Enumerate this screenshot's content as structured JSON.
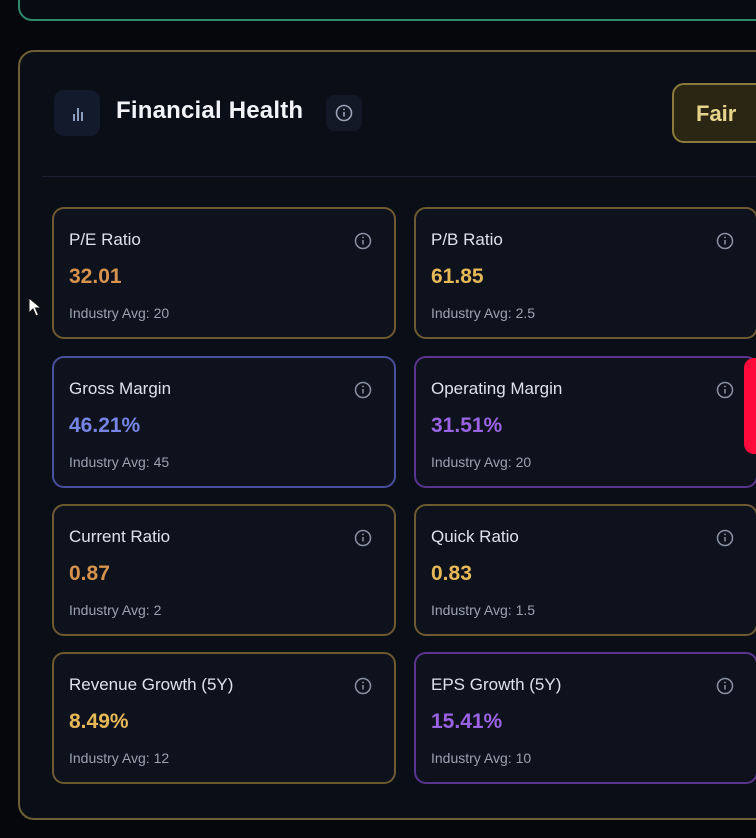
{
  "panel": {
    "title": "Financial Health",
    "rating": "Fair",
    "icons": {
      "header": "bar-chart-icon",
      "info": "info-circle-icon"
    }
  },
  "metrics": [
    {
      "label": "P/E Ratio",
      "value": "32.01",
      "avg": "Industry Avg: 20",
      "accent": "#d7934e"
    },
    {
      "label": "P/B Ratio",
      "value": "61.85",
      "avg": "Industry Avg: 2.5",
      "accent": "#e7b857"
    },
    {
      "label": "Gross Margin",
      "value": "46.21%",
      "avg": "Industry Avg: 45",
      "accent": "#7784e6"
    },
    {
      "label": "Operating Margin",
      "value": "31.51%",
      "avg": "Industry Avg: 20",
      "accent": "#9b63e3"
    },
    {
      "label": "Current Ratio",
      "value": "0.87",
      "avg": "Industry Avg: 2",
      "accent": "#d7934e"
    },
    {
      "label": "Quick Ratio",
      "value": "0.83",
      "avg": "Industry Avg: 1.5",
      "accent": "#e7b857"
    },
    {
      "label": "Revenue Growth (5Y)",
      "value": "8.49%",
      "avg": "Industry Avg: 12",
      "accent": "#e7b857"
    },
    {
      "label": "EPS Growth (5Y)",
      "value": "15.41%",
      "avg": "Industry Avg: 10",
      "accent": "#9b63e3"
    }
  ]
}
